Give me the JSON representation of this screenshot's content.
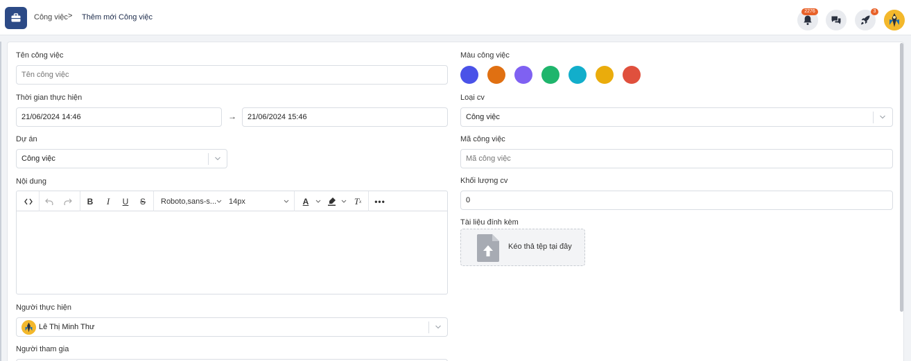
{
  "breadcrumb": {
    "parent": "Công việc",
    "separator": ">",
    "current": "Thêm mới Công việc"
  },
  "header": {
    "notification_count": "2276",
    "rocket_count": "3"
  },
  "form": {
    "task_name": {
      "label": "Tên công việc",
      "placeholder": "Tên công việc"
    },
    "time": {
      "label": "Thời gian thực hiện",
      "start": "21/06/2024 14:46",
      "arrow": "→",
      "end": "21/06/2024 15:46"
    },
    "project": {
      "label": "Dự án",
      "value": "Công việc"
    },
    "content": {
      "label": "Nội dung"
    },
    "assignee": {
      "label": "Người thực hiện",
      "value": "Lê Thị Minh Thư"
    },
    "participants": {
      "label": "Người tham gia"
    },
    "color": {
      "label": "Màu công việc",
      "options": [
        "#4a52e8",
        "#e07012",
        "#7f61f2",
        "#1fb56c",
        "#12aecb",
        "#eaac0c",
        "#e0503d"
      ]
    },
    "type": {
      "label": "Loại cv",
      "value": "Công việc"
    },
    "code": {
      "label": "Mã công việc",
      "placeholder": "Mã công việc"
    },
    "volume": {
      "label": "Khối lượng cv",
      "value": "0"
    },
    "attachment": {
      "label": "Tài liệu đính kèm",
      "drop_text": "Kéo thả tệp tại đây"
    }
  },
  "editor_toolbar": {
    "font_family": "Roboto,sans-s...",
    "font_size": "14px"
  },
  "colors": {
    "brand": "#2c4a86",
    "badge": "#e8622a"
  }
}
